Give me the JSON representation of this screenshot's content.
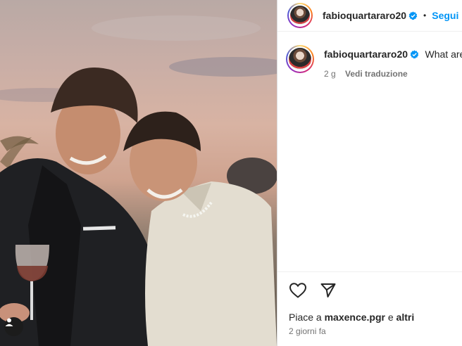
{
  "post": {
    "username": "fabioquartararo20",
    "separator": "•",
    "follow_label": "Segui",
    "caption_text": "What are",
    "caption_age": "2 g",
    "translate_label": "Vedi traduzione",
    "likes_prefix": "Piace a",
    "likes_user": "maxence.pgr",
    "likes_conj": "e",
    "likes_others": "altri",
    "timestamp": "2 giorni fa"
  },
  "icons": {
    "like": "heart-icon",
    "share": "send-icon",
    "verified": "verified-badge-icon",
    "tag": "user-tag-icon"
  },
  "colors": {
    "accent": "#0095f6",
    "verified": "#0095f6",
    "muted": "#737373"
  }
}
